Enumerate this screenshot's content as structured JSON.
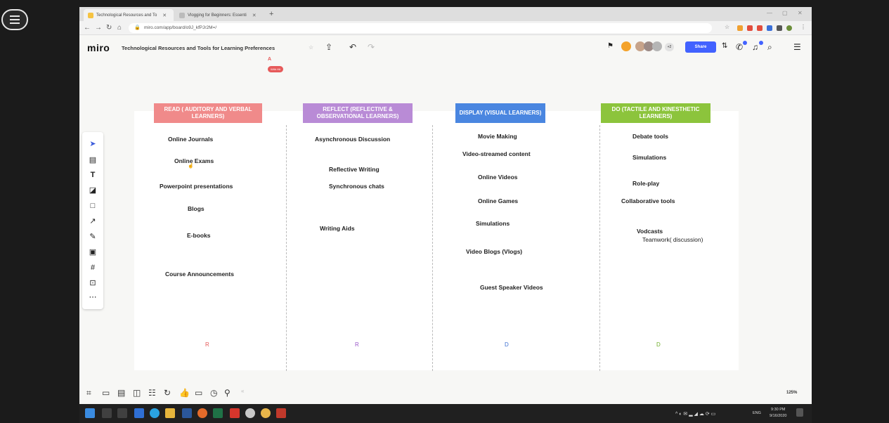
{
  "browser": {
    "tabs": [
      {
        "label": "Technological Resources and To",
        "active": true
      },
      {
        "label": "Vlogging for Beginners: Essenti",
        "active": false
      }
    ],
    "url": "miro.com/app/board/o9J_kfPJr2M=/"
  },
  "miro": {
    "logo": "miro",
    "board_title": "Technological Resources and Tools for Learning Preferences",
    "collaborator_cursor_letter": "A",
    "collaborator_tag": "With Hit",
    "more_users": "+2",
    "share_label": "Share"
  },
  "columns": [
    {
      "header": "READ ( AUDITORY AND VERBAL LEARNERS)",
      "color": "#f08a8a",
      "letter": "R",
      "letter_color": "#e65a5a",
      "items": [
        "Online Journals",
        "Online Exams",
        "Powerpoint presentations",
        "Blogs",
        "E-books",
        "Course Announcements"
      ]
    },
    {
      "header": "REFLECT (REFLECTIVE & OBSERVATIONAL LEARNERS)",
      "color": "#b98bd6",
      "letter": "R",
      "letter_color": "#9b59c9",
      "items": [
        "Asynchronous Discussion",
        "Reflective Writing",
        "Synchronous chats",
        "Writing Aids"
      ]
    },
    {
      "header": "DISPLAY (VISUAL LEARNERS)",
      "color": "#4a86e0",
      "letter": "D",
      "letter_color": "#3b6fd1",
      "items": [
        "Movie Making",
        "Video-streamed content",
        "Online Videos",
        "Online Games",
        "Simulations",
        "Video Blogs (Vlogs)",
        "Guest Speaker Videos"
      ]
    },
    {
      "header": "DO (TACTILE AND KINESTHETIC LEARNERS)",
      "color": "#8cc43c",
      "letter": "D",
      "letter_color": "#6fae2a",
      "items": [
        "Debate tools",
        "Simulations",
        "Role-play",
        "Collaborative tools",
        "Vodcasts",
        "Teamwork( discussion)"
      ]
    }
  ],
  "zoom": "125%",
  "taskbar": {
    "lang": "ENG",
    "time": "9:30 PM",
    "date": "9/16/2020"
  },
  "colors": {
    "share_button": "#4262ff",
    "collaborator": "#e65a5a"
  }
}
